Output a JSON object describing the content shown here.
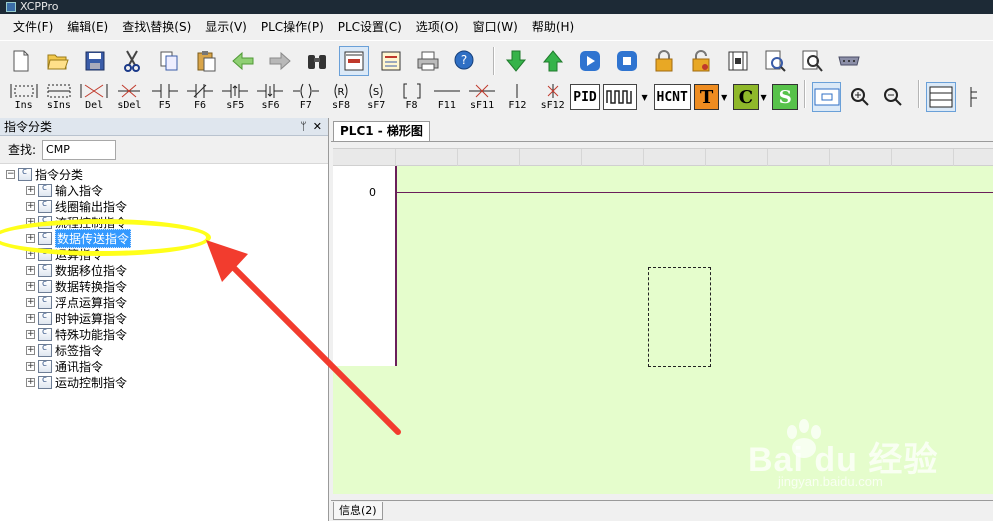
{
  "window": {
    "title": "XCPPro"
  },
  "menu": [
    "文件(F)",
    "编辑(E)",
    "查找\\替换(S)",
    "显示(V)",
    "PLC操作(P)",
    "PLC设置(C)",
    "选项(O)",
    "窗口(W)",
    "帮助(H)"
  ],
  "toolbar1": {
    "buttons": [
      "new-file",
      "open-folder",
      "save",
      "cut",
      "copy",
      "paste",
      "undo-arrow",
      "redo-arrow",
      "find-binoculars",
      "ladder-view",
      "instruction-list",
      "print",
      "help-cursor",
      "download",
      "upload",
      "run",
      "stop",
      "lock",
      "unlock",
      "monitor",
      "search-doc",
      "zoom-doc",
      "serial-port"
    ]
  },
  "toolbar2": {
    "ladder_buttons": [
      {
        "icon": "ins-icon",
        "label": "Ins"
      },
      {
        "icon": "sins-icon",
        "label": "sIns"
      },
      {
        "icon": "del-icon",
        "label": "Del"
      },
      {
        "icon": "sdel-icon",
        "label": "sDel"
      },
      {
        "icon": "no-contact-icon",
        "label": "F5"
      },
      {
        "icon": "nc-contact-icon",
        "label": "F6"
      },
      {
        "icon": "rising-contact-icon",
        "label": "sF5"
      },
      {
        "icon": "falling-contact-icon",
        "label": "sF6"
      },
      {
        "icon": "coil-icon",
        "label": "F7"
      },
      {
        "icon": "reset-coil-icon",
        "label": "sF8"
      },
      {
        "icon": "set-coil-icon",
        "label": "sF7"
      },
      {
        "icon": "instruction-bracket-icon",
        "label": "F8"
      },
      {
        "icon": "hline-icon",
        "label": "F11"
      },
      {
        "icon": "delete-hline-icon",
        "label": "sF11"
      },
      {
        "icon": "vline-icon",
        "label": "F12"
      },
      {
        "icon": "delete-vline-icon",
        "label": "sF12"
      }
    ],
    "box_buttons": [
      "PID",
      "HCNT"
    ],
    "colored_buttons": [
      {
        "letter": "T",
        "color": "#ee8c20"
      },
      {
        "letter": "C",
        "color": "#8fb82a"
      },
      {
        "letter": "S",
        "color": "#57c24a"
      }
    ]
  },
  "left_panel": {
    "title": "指令分类",
    "pin_label": "ᛘ",
    "close_label": "✕",
    "search_label": "查找:",
    "search_value": "CMP",
    "tree_root": "指令分类",
    "tree_items": [
      "输入指令",
      "线圈输出指令",
      "流程控制指令",
      "数据传送指令",
      "运算指令",
      "数据移位指令",
      "数据转换指令",
      "浮点运算指令",
      "时钟运算指令",
      "特殊功能指令",
      "标签指令",
      "通讯指令",
      "运动控制指令"
    ],
    "selected_index": 3
  },
  "editor": {
    "tab_label": "PLC1 - 梯形图",
    "row_number": "0"
  },
  "info_bar": {
    "tab_label": "信息(2)"
  },
  "watermark": {
    "brand": "Bai du 经验",
    "url": "jingyan.baidu.com"
  },
  "annotation": {
    "highlight_color": "#ffff1a",
    "arrow_color": "#f23c2e"
  }
}
